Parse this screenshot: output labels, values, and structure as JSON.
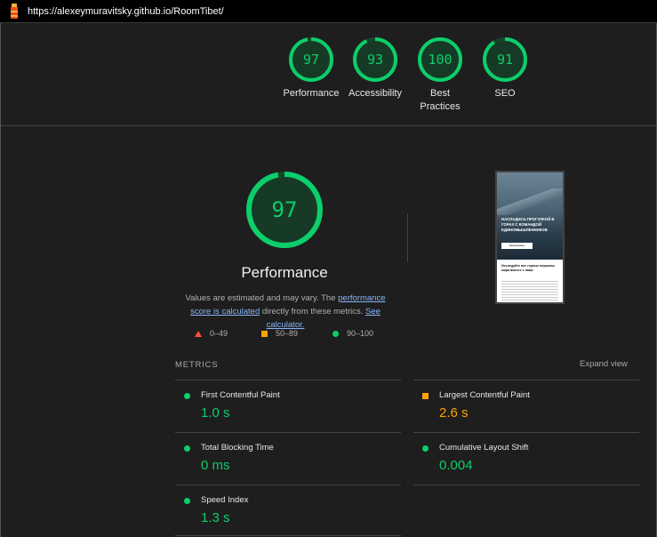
{
  "browser": {
    "url": "https://alexeymuravitsky.github.io/RoomTibet/"
  },
  "summary_scores": [
    {
      "label": "Performance",
      "score": "97",
      "value": 97
    },
    {
      "label": "Accessibility",
      "score": "93",
      "value": 93
    },
    {
      "label": "Best Practices",
      "score": "100",
      "value": 100
    },
    {
      "label": "SEO",
      "score": "91",
      "value": 91
    }
  ],
  "performance": {
    "score": "97",
    "value": 97,
    "title": "Performance",
    "desc_prefix": "Values are estimated and may vary. The ",
    "link_score": "performance score is calculated",
    "desc_middle": " directly from these metrics. ",
    "link_calculator": "See calculator."
  },
  "legend": [
    {
      "range": "0–49",
      "color": "#ff4e42",
      "icon": "triangle-icon"
    },
    {
      "range": "50–89",
      "color": "#ffa400",
      "icon": "square-icon"
    },
    {
      "range": "90–100",
      "color": "#0cce6b",
      "icon": "circle-icon"
    }
  ],
  "screenshot": {
    "hero_text": "НАСЛАДИСЬ ПРОГУЛКОЙ В ГОРАХ С КОМАНДОЙ ЕДИНОМЫШЛЕННИКОВ",
    "hero_button": "Забронировать",
    "body_title": "Исследуйте все горные вершины мира вместе с нами"
  },
  "metrics_header": {
    "title": "METRICS",
    "expand": "Expand view"
  },
  "metrics": [
    {
      "name": "First Contentful Paint",
      "value": "1.0 s",
      "status": "good"
    },
    {
      "name": "Largest Contentful Paint",
      "value": "2.6 s",
      "status": "average"
    },
    {
      "name": "Total Blocking Time",
      "value": "0 ms",
      "status": "good"
    },
    {
      "name": "Cumulative Layout Shift",
      "value": "0.004",
      "status": "good"
    },
    {
      "name": "Speed Index",
      "value": "1.3 s",
      "status": "good"
    }
  ],
  "colors": {
    "good": "#0cce6b",
    "average": "#ffa400",
    "fail": "#ff4e42",
    "background": "#1e1e1e"
  }
}
